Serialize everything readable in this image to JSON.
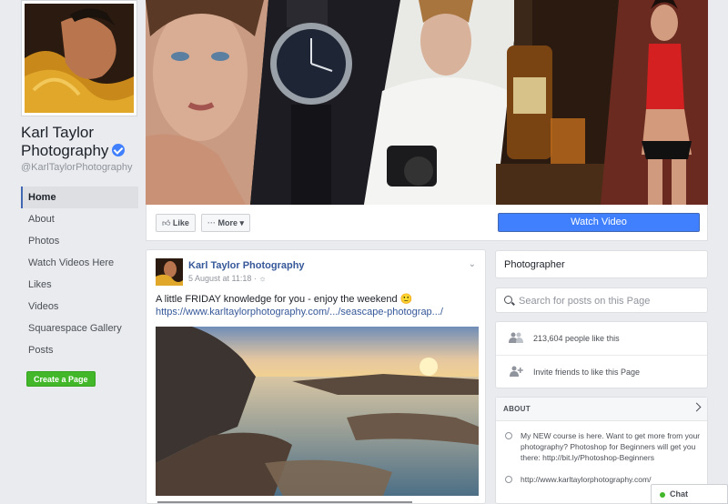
{
  "page": {
    "name_line1": "Karl Taylor",
    "name_line2": "Photography",
    "handle": "@KarlTaylorPhotography"
  },
  "nav": {
    "items": [
      {
        "label": "Home"
      },
      {
        "label": "About"
      },
      {
        "label": "Photos"
      },
      {
        "label": "Watch Videos Here"
      },
      {
        "label": "Likes"
      },
      {
        "label": "Videos"
      },
      {
        "label": "Squarespace Gallery"
      },
      {
        "label": "Posts"
      }
    ],
    "create_page": "Create a Page"
  },
  "actions": {
    "like": "Like",
    "more": "More",
    "watch_video": "Watch Video"
  },
  "post": {
    "author": "Karl Taylor Photography",
    "date": "5 August at 11:18 · ☼",
    "text": "A little FRIDAY knowledge for you - enjoy the weekend 🙂",
    "link": "https://www.karltaylorphotography.com/.../seascape-photograp.../"
  },
  "sidebar": {
    "category": "Photographer",
    "search_placeholder": "Search for posts on this Page",
    "likes_count": "213,604 people like this",
    "invite": "Invite friends to like this Page",
    "about_title": "ABOUT",
    "about_text": "My NEW course is here. Want to get more from your photography? Photoshop for Beginners will get you there: http://bit.ly/Photoshop-Beginners",
    "about_url": "http://www.karltaylorphotography.com/"
  },
  "chat": {
    "label": "Chat"
  },
  "colors": {
    "accent": "#4080ff",
    "link": "#365899",
    "create_button": "#42b72a",
    "background": "#e9ebee"
  }
}
